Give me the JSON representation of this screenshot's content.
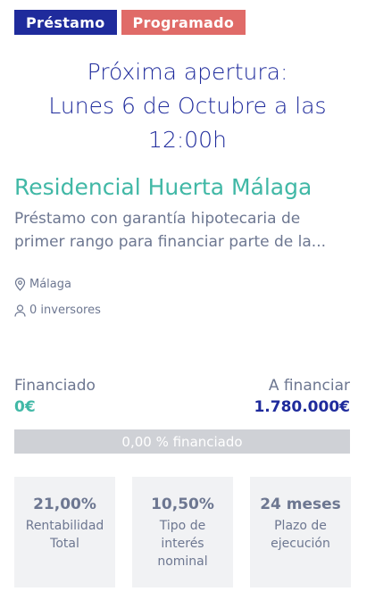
{
  "badges": {
    "loan": "Préstamo",
    "status": "Programado"
  },
  "opening": {
    "line1": "Próxima apertura:",
    "line2": "Lunes 6 de Octubre a las",
    "line3": "12:00h"
  },
  "project": {
    "title": "Residencial Huerta Málaga",
    "description_line1": "Préstamo con garantía hipotecaria de",
    "description_line2": "primer rango para financiar parte de la..."
  },
  "meta": {
    "location": "Málaga",
    "location_icon": "map-pin-icon",
    "investors": "0 inversores",
    "investors_icon": "user-icon"
  },
  "funding": {
    "funded_label": "Financiado",
    "funded_value": "0€",
    "to_fund_label": "A financiar",
    "to_fund_value": "1.780.000€",
    "progress_fraction": 0.0,
    "progress_text": "0,00 % financiado"
  },
  "stats": [
    {
      "value": "21,00%",
      "label_lines": [
        "Rentabilidad",
        "Total"
      ]
    },
    {
      "value": "10,50%",
      "label_lines": [
        "Tipo de",
        "interés",
        "nominal"
      ]
    },
    {
      "value": "24 meses",
      "label_lines": [
        "Plazo de",
        "ejecución"
      ]
    }
  ],
  "colors": {
    "navy": "#1f2b9c",
    "teal": "#41b8a6",
    "coral": "#e06b68",
    "gray_text": "#6d7791",
    "progress_bg": "#cfd1d6",
    "stat_bg": "#f1f2f4"
  }
}
